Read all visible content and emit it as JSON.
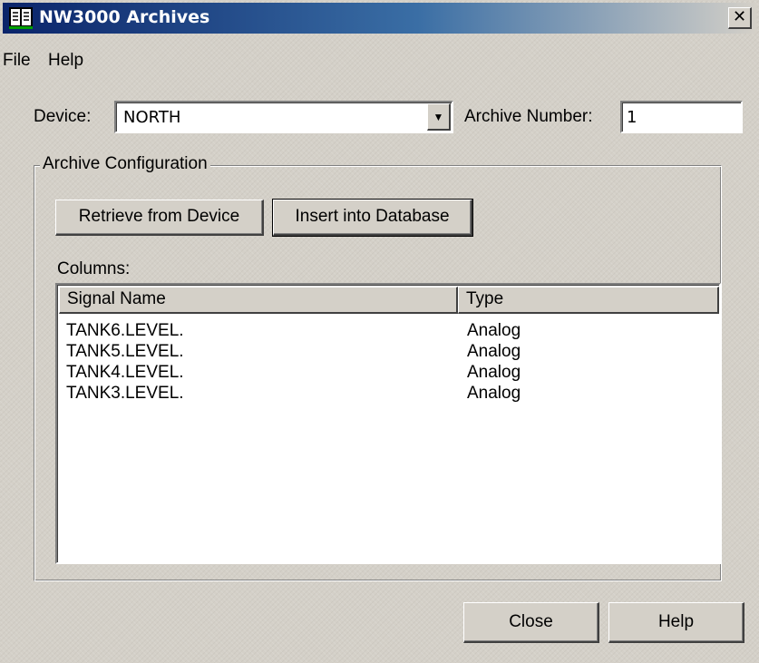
{
  "window": {
    "title": "NW3000 Archives",
    "close_glyph": "✕"
  },
  "menu": {
    "items": [
      "File",
      "Help"
    ]
  },
  "device": {
    "label": "Device:",
    "value": "NORTH",
    "dropdown_glyph": "▼"
  },
  "archive_number": {
    "label": "Archive Number:",
    "value": "1"
  },
  "archive_config": {
    "title": "Archive Configuration",
    "retrieve_label": "Retrieve from Device",
    "insert_label": "Insert into Database",
    "columns_label": "Columns:",
    "table": {
      "headers": [
        "Signal Name",
        "Type"
      ],
      "rows": [
        [
          "TANK6.LEVEL.",
          "Analog"
        ],
        [
          "TANK5.LEVEL.",
          "Analog"
        ],
        [
          "TANK4.LEVEL.",
          "Analog"
        ],
        [
          "TANK3.LEVEL.",
          "Analog"
        ]
      ]
    }
  },
  "footer": {
    "close_label": "Close",
    "help_label": "Help"
  }
}
